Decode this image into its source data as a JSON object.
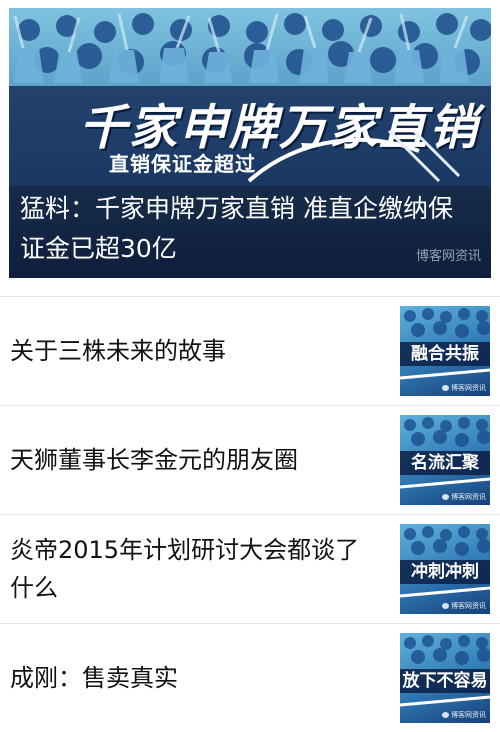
{
  "hero": {
    "image_headline": "千家申牌万家直销",
    "image_subline": "直销保证金超过",
    "title": "猛料：千家申牌万家直销 准直企缴纳保证金已超30亿",
    "watermark": "博客网资讯"
  },
  "news": [
    {
      "title": "关于三株未来的故事",
      "thumb_label": "融合共振",
      "thumb_mark": "博客网资讯"
    },
    {
      "title": "天狮董事长李金元的朋友圈",
      "thumb_label": "名流汇聚",
      "thumb_mark": "博客网资讯"
    },
    {
      "title": "炎帝2015年计划研讨大会都谈了什么",
      "thumb_label": "冲刺冲刺",
      "thumb_mark": "博客网资讯"
    },
    {
      "title": "成刚：售卖真实",
      "thumb_label": "放下不容易",
      "thumb_mark": "博客网资讯"
    }
  ],
  "colors": {
    "thumb_bg": "#2f78b4",
    "caption_bg": "#0a1226",
    "divider": "#e4e4e4"
  }
}
